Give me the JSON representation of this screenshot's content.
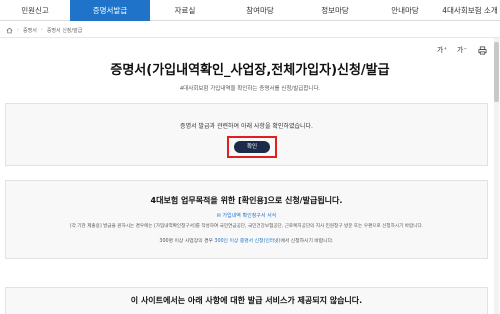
{
  "nav": {
    "items": [
      {
        "label": "민원신고"
      },
      {
        "label": "증명서발급"
      },
      {
        "label": "자료실"
      },
      {
        "label": "참여마당"
      },
      {
        "label": "정보마당"
      },
      {
        "label": "안내마당"
      },
      {
        "label": "4대사회보험 소개"
      }
    ],
    "active_index": 1
  },
  "breadcrumb": {
    "home_icon": "home-icon",
    "items": [
      "증명서",
      "증명서 신청/발급"
    ]
  },
  "tools": {
    "font_increase": "가⁺",
    "font_decrease": "가⁻"
  },
  "page": {
    "title": "증명서(가입내역확인_사업장,전체가입자)신청/발급",
    "subtitle": "4대사회보험 가입내역을 확인하는 증명서를 신청/발급합니다."
  },
  "notice_box": {
    "message": "증명서 발급과 관련하여 아래 사항을 확인하였습니다.",
    "confirm_label": "확인"
  },
  "info_box": {
    "title": "4대보험 업무목적을 위한 [확인용]으로 신청/발급됩니다.",
    "link": "✉ 가입내역 확인청구서 서식",
    "desc": "[각 기관 제출용] 발급을 원하시는 경우에는 [가입내역확인청구서]를 작성하여 국민연금공단, 국민건강보험공단, 근로복지공단의 지사 민원창구 방문 또는 우편으로 신청하시기 바랍니다.",
    "note_prefix": "300명 이상 사업장의 경우 ",
    "note_highlight": "300인 이상 증명서 신청(인터넷)",
    "note_suffix": "에서 신청하시기 바랍니다."
  },
  "lower_box": {
    "title": "이 사이트에서는 아래 사항에 대한 발급 서비스가 제공되지 않습니다."
  },
  "colors": {
    "nav_active": "#1f73c9",
    "confirm_button": "#1c2b4a",
    "highlight_outline": "#e02020",
    "link": "#1f73c9"
  }
}
